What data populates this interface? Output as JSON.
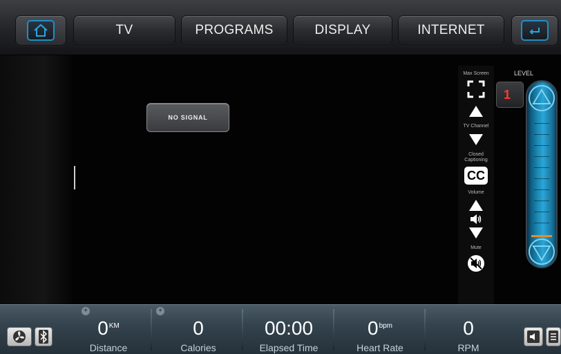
{
  "nav": {
    "home_icon": "home-icon",
    "tabs": [
      {
        "label": "TV"
      },
      {
        "label": "PROGRAMS"
      },
      {
        "label": "DISPLAY"
      },
      {
        "label": "INTERNET"
      }
    ],
    "back_icon": "back-arrow-icon"
  },
  "video": {
    "status": "NO SIGNAL"
  },
  "controls": {
    "max_screen_label": "Max Screen",
    "tv_channel_label": "TV Channel",
    "closed_captioning_label": "Closed Captioning",
    "cc_text": "CC",
    "volume_label": "Volume",
    "mute_label": "Mute"
  },
  "level": {
    "label": "LEVEL",
    "value": "1"
  },
  "stats": [
    {
      "value": "0",
      "unit": "KM",
      "label": "Distance"
    },
    {
      "value": "0",
      "unit": "",
      "label": "Calories"
    },
    {
      "value": "00:00",
      "unit": "",
      "label": "Elapsed Time"
    },
    {
      "value": "0",
      "unit": "bpm",
      "label": "Heart Rate"
    },
    {
      "value": "0",
      "unit": "",
      "label": "RPM"
    }
  ],
  "colors": {
    "accent": "#1e8fc7",
    "level_number": "#ff3b30",
    "level_marker": "#e68b2c"
  }
}
